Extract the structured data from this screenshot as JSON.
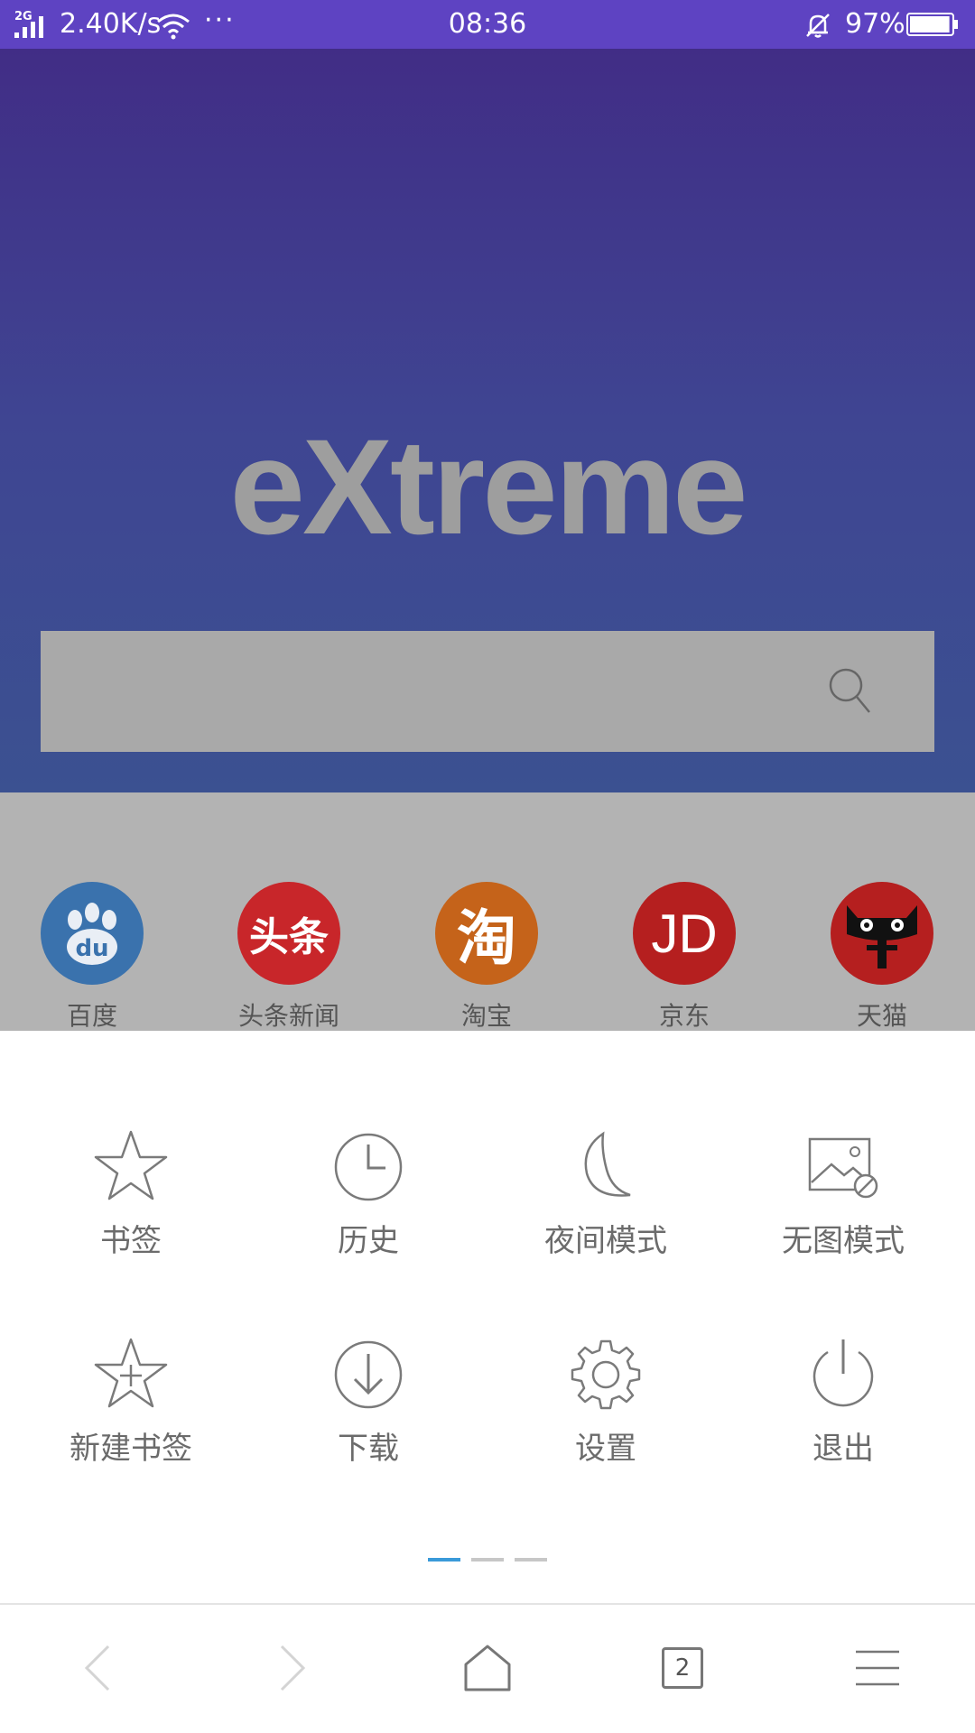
{
  "status_bar": {
    "network_type": "2G",
    "speed": "2.40K/s",
    "more": "···",
    "time": "08:36",
    "battery": "97%",
    "battery_level": 0.97
  },
  "hero": {
    "logo": "eXtreme",
    "search": {
      "placeholder": ""
    }
  },
  "quick_links": [
    {
      "label": "百度",
      "logo_text": "du",
      "color": "#3a72ad"
    },
    {
      "label": "头条新闻",
      "logo_text": "头条",
      "color": "#c8262a"
    },
    {
      "label": "淘宝",
      "logo_text": "淘",
      "color": "#c5631a"
    },
    {
      "label": "京东",
      "logo_text": "JD",
      "color": "#b51f1f"
    },
    {
      "label": "天猫",
      "logo_text": "",
      "color": "#b51f1f"
    }
  ],
  "menu": {
    "items": [
      {
        "label": "书签",
        "icon": "star-icon"
      },
      {
        "label": "历史",
        "icon": "clock-icon"
      },
      {
        "label": "夜间模式",
        "icon": "moon-icon"
      },
      {
        "label": "无图模式",
        "icon": "no-image-icon"
      },
      {
        "label": "新建书签",
        "icon": "star-plus-icon"
      },
      {
        "label": "下载",
        "icon": "download-icon"
      },
      {
        "label": "设置",
        "icon": "gear-icon"
      },
      {
        "label": "退出",
        "icon": "power-icon"
      }
    ],
    "page_count": 3,
    "active_page": 0,
    "active_color": "#3a9ad9"
  },
  "bottom_nav": {
    "tabs_count": "2"
  }
}
